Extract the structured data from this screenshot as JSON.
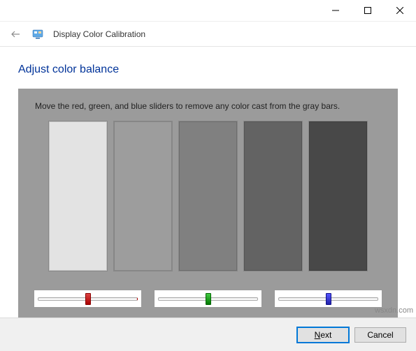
{
  "window": {
    "app_title": "Display Color Calibration"
  },
  "page": {
    "heading": "Adjust color balance",
    "instruction": "Move the red, green, and blue sliders to remove any color cast from the gray bars.",
    "swatches": [
      "#e3e3e3",
      "#9d9d9d",
      "#808080",
      "#636363",
      "#484848"
    ],
    "sliders": {
      "red": 50,
      "green": 50,
      "blue": 50
    }
  },
  "footer": {
    "next_label": "Next",
    "cancel_label": "Cancel"
  },
  "watermark": "wsxdn.com"
}
